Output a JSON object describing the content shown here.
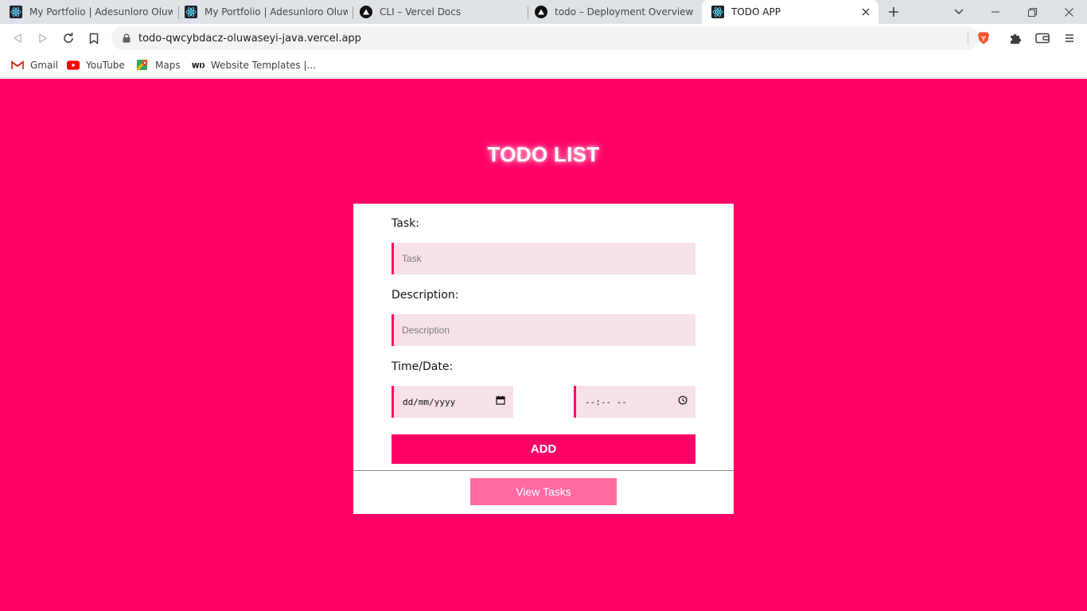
{
  "browser": {
    "tabs": [
      {
        "title": "My Portfolio | Adesunloro Oluwaseyi",
        "favicon": "react-icon",
        "active": false
      },
      {
        "title": "My Portfolio | Adesunloro Oluwaseyi",
        "favicon": "react-icon",
        "active": false
      },
      {
        "title": "CLI – Vercel Docs",
        "favicon": "vercel-icon",
        "active": false
      },
      {
        "title": "todo – Deployment Overview",
        "favicon": "vercel-icon",
        "active": false
      },
      {
        "title": "TODO APP",
        "favicon": "react-icon",
        "active": true
      }
    ],
    "url": "todo-qwcybdacz-oluwaseyi-java.vercel.app",
    "bookmarks": [
      {
        "label": "Gmail",
        "icon": "gmail-icon"
      },
      {
        "label": "YouTube",
        "icon": "youtube-icon"
      },
      {
        "label": "Maps",
        "icon": "maps-icon"
      },
      {
        "label": "Website Templates |...",
        "icon": "wix-icon"
      }
    ],
    "colors": {
      "tabstrip": "#dee1e6",
      "brave": "#fb542b"
    }
  },
  "page": {
    "title": "TODO LIST",
    "task_label": "Task:",
    "task_placeholder": "Task",
    "description_label": "Description:",
    "description_placeholder": "Description",
    "datetime_label": "Time/Date:",
    "date_placeholder": "dd/mm/yyyy",
    "time_placeholder": "--:-- --",
    "add_label": "ADD",
    "view_label": "View Tasks",
    "colors": {
      "background": "#ff0066",
      "input_bg": "#f6e1e7",
      "view_button": "#ff6aa3"
    }
  }
}
